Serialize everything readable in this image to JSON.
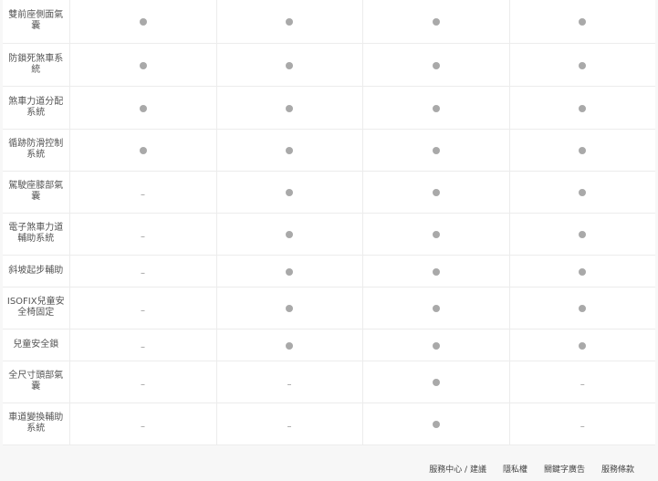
{
  "spec_rows": [
    {
      "label": "雙前座側面氣囊",
      "values": [
        "dot",
        "dot",
        "dot",
        "dot"
      ]
    },
    {
      "label": "防鎖死煞車系統",
      "values": [
        "dot",
        "dot",
        "dot",
        "dot"
      ]
    },
    {
      "label": "煞車力道分配系統",
      "values": [
        "dot",
        "dot",
        "dot",
        "dot"
      ]
    },
    {
      "label": "循跡防滑控制系統",
      "values": [
        "dot",
        "dot",
        "dot",
        "dot"
      ]
    },
    {
      "label": "駕駛座膝部氣囊",
      "values": [
        "dash",
        "dot",
        "dot",
        "dot"
      ]
    },
    {
      "label": "電子煞車力道輔助系統",
      "values": [
        "dash",
        "dot",
        "dot",
        "dot"
      ]
    },
    {
      "label": "斜坡起步輔助",
      "values": [
        "dash",
        "dot",
        "dot",
        "dot"
      ]
    },
    {
      "label": "ISOFIX兒童安全椅固定",
      "values": [
        "dash",
        "dot",
        "dot",
        "dot"
      ]
    },
    {
      "label": "兒童安全鎖",
      "values": [
        "dash",
        "dot",
        "dot",
        "dot"
      ]
    },
    {
      "label": "全尺寸頭部氣囊",
      "values": [
        "dash",
        "dash",
        "dot",
        "dash"
      ]
    },
    {
      "label": "車道變換輔助系統",
      "values": [
        "dash",
        "dash",
        "dot",
        "dash"
      ]
    }
  ],
  "dash_symbol": "–",
  "colors": {
    "dot": "#a9a9a9",
    "grid": "#ececec",
    "background": "#f7f7f7"
  },
  "footer": {
    "links": [
      "服務中心 / 建議",
      "隱私權",
      "關鍵字廣告",
      "服務條款"
    ]
  }
}
